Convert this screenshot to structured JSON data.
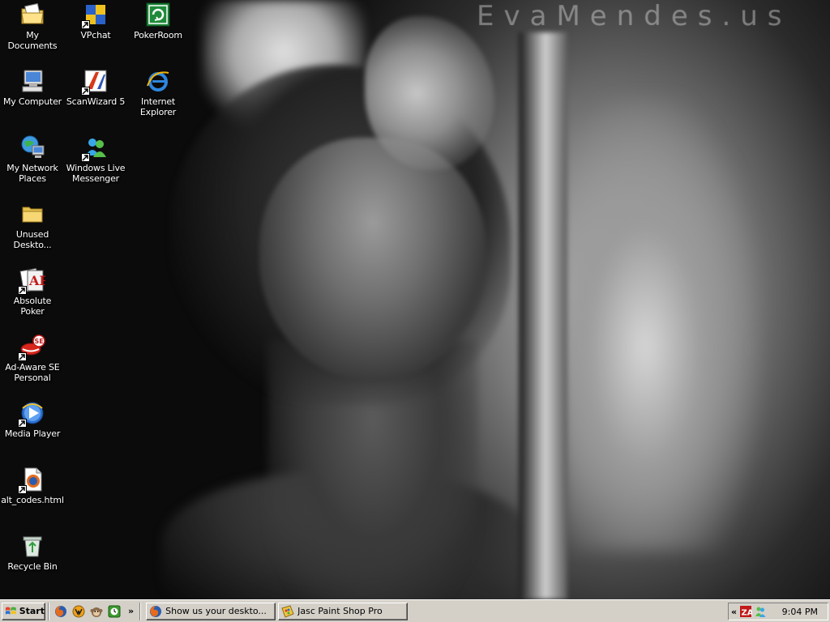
{
  "wallpaper": {
    "brand_text": "EvaMendes.us"
  },
  "desktop_icons": [
    {
      "label": "My Documents",
      "icon": "my-documents-icon"
    },
    {
      "label": "VPchat",
      "icon": "vpchat-icon"
    },
    {
      "label": "PokerRoom",
      "icon": "pokerroom-icon"
    },
    {
      "label": "My Computer",
      "icon": "my-computer-icon"
    },
    {
      "label": "ScanWizard 5",
      "icon": "scanwizard-icon"
    },
    {
      "label": "Internet Explorer",
      "icon": "internet-explorer-icon"
    },
    {
      "label": "My Network Places",
      "icon": "network-places-icon"
    },
    {
      "label": "Windows Live Messenger",
      "icon": "messenger-icon"
    },
    {
      "label": "Unused Deskto...",
      "icon": "folder-icon"
    },
    {
      "label": "Absolute Poker",
      "icon": "absolute-poker-icon"
    },
    {
      "label": "Ad-Aware SE Personal",
      "icon": "ad-aware-icon"
    },
    {
      "label": "Media Player",
      "icon": "media-player-icon"
    },
    {
      "label": "alt_codes.html",
      "icon": "html-file-icon"
    },
    {
      "label": "Recycle Bin",
      "icon": "recycle-bin-icon"
    }
  ],
  "taskbar": {
    "start_label": "Start",
    "quick_launch": [
      "firefox-icon",
      "winamp-icon",
      "monkey-icon",
      "green-clock-icon"
    ],
    "quick_launch_more": "»",
    "tasks": [
      {
        "label": "Show us your deskto...",
        "icon": "firefox-icon"
      },
      {
        "label": "Jasc Paint Shop Pro",
        "icon": "paint-shop-pro-icon"
      }
    ],
    "tray": {
      "expand": "«",
      "icons": [
        "zonealarm-icon",
        "messenger-tray-icon"
      ],
      "clock": "9:04 PM"
    }
  }
}
